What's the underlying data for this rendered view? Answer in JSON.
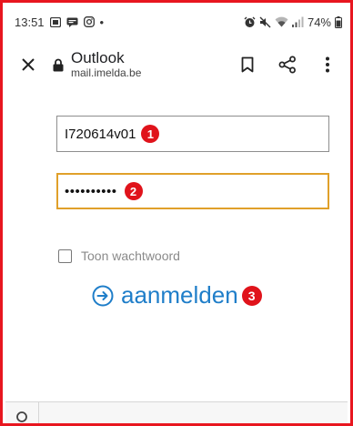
{
  "status_bar": {
    "time": "13:51",
    "dot": "•",
    "battery": "74%"
  },
  "browser": {
    "title": "Outlook",
    "url": "mail.imelda.be"
  },
  "login_form": {
    "username_value": "I720614v01",
    "password_value": "••••••••••",
    "show_password_label": "Toon wachtwoord",
    "login_label": "aanmelden"
  },
  "annotations": {
    "badge_1": "1",
    "badge_2": "2",
    "badge_3": "3"
  },
  "colors": {
    "frame": "#e8161f",
    "badge": "#e0131b",
    "focus_border": "#e0a02a",
    "link": "#1f7ec9"
  },
  "icons": {
    "close": "close-icon",
    "lock": "lock-icon",
    "bookmark": "bookmark-icon",
    "share": "share-icon",
    "menu": "more-vert-icon",
    "login": "arrow-circle-right-icon"
  }
}
